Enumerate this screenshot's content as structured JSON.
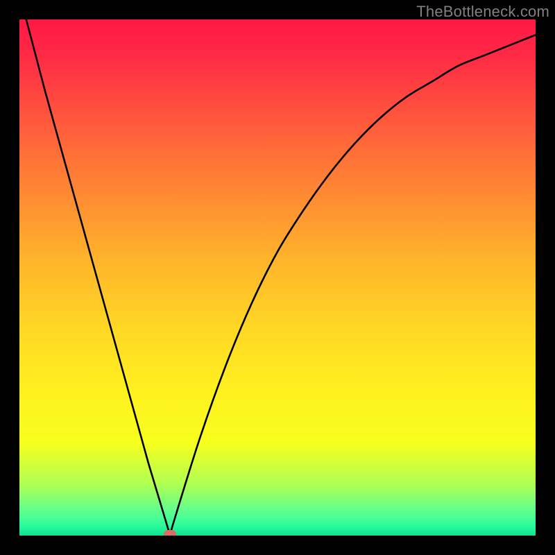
{
  "watermark": "TheBottleneck.com",
  "chart_data": {
    "type": "line",
    "title": "",
    "xlabel": "",
    "ylabel": "",
    "x_range": [
      0,
      1
    ],
    "y_range": [
      0,
      1
    ],
    "series": [
      {
        "name": "bottleneck-curve",
        "x": [
          0.0,
          0.05,
          0.1,
          0.15,
          0.2,
          0.25,
          0.292,
          0.3,
          0.35,
          0.4,
          0.45,
          0.5,
          0.55,
          0.6,
          0.65,
          0.7,
          0.75,
          0.8,
          0.85,
          0.9,
          0.95,
          1.0
        ],
        "y": [
          1.05,
          0.86,
          0.68,
          0.5,
          0.32,
          0.14,
          0.0,
          0.03,
          0.19,
          0.33,
          0.45,
          0.55,
          0.63,
          0.7,
          0.76,
          0.81,
          0.85,
          0.88,
          0.91,
          0.93,
          0.95,
          0.97
        ]
      }
    ],
    "marker": {
      "x": 0.292,
      "y": 0.003
    },
    "gradient_stops": [
      {
        "pos": 0.0,
        "color": "#ff1846"
      },
      {
        "pos": 0.5,
        "color": "#ffd824"
      },
      {
        "pos": 0.82,
        "color": "#f7ff1d"
      },
      {
        "pos": 1.0,
        "color": "#10e090"
      }
    ],
    "grid": false,
    "legend": false
  }
}
